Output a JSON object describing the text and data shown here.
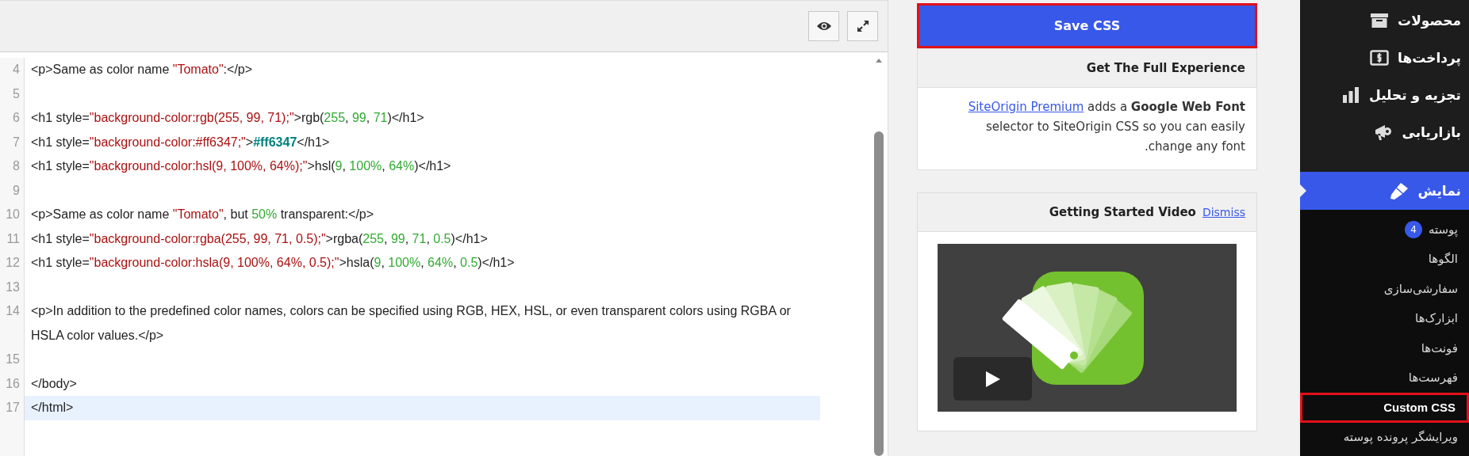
{
  "editor": {
    "toolbar": {
      "buttons": [
        {
          "kind": "preview"
        },
        {
          "kind": "expand"
        }
      ]
    },
    "lines": [
      {
        "number": "4",
        "segments": [
          {
            "kind": "text",
            "text": "<p>Same as color name "
          },
          {
            "kind": "string",
            "text": "\"Tomato\""
          },
          {
            "kind": "text",
            "text": ":</p>"
          }
        ]
      },
      {
        "number": "5"
      },
      {
        "number": "6",
        "segments": [
          {
            "kind": "text",
            "text": "<h1 style="
          },
          {
            "kind": "string",
            "text": "\"background-color:rgb(255, 99, 71);\""
          },
          {
            "kind": "text",
            "text": ">rgb("
          },
          {
            "kind": "number",
            "text": "255"
          },
          {
            "kind": "text",
            "text": ", "
          },
          {
            "kind": "number",
            "text": "99"
          },
          {
            "kind": "text",
            "text": ", "
          },
          {
            "kind": "number",
            "text": "71"
          },
          {
            "kind": "text",
            "text": ")</h1>"
          }
        ]
      },
      {
        "number": "7",
        "segments": [
          {
            "kind": "text",
            "text": "<h1 style="
          },
          {
            "kind": "string",
            "text": "\"background-color:#ff6347;\""
          },
          {
            "kind": "text",
            "text": ">"
          },
          {
            "kind": "color",
            "text": "#ff6347"
          },
          {
            "kind": "text",
            "text": "</h1>"
          }
        ]
      },
      {
        "number": "8",
        "segments": [
          {
            "kind": "text",
            "text": "<h1 style="
          },
          {
            "kind": "string",
            "text": "\"background-color:hsl(9, 100%, 64%);\""
          },
          {
            "kind": "text",
            "text": ">hsl("
          },
          {
            "kind": "number",
            "text": "9"
          },
          {
            "kind": "text",
            "text": ", "
          },
          {
            "kind": "number",
            "text": "100%"
          },
          {
            "kind": "text",
            "text": ", "
          },
          {
            "kind": "number",
            "text": "64%"
          },
          {
            "kind": "text",
            "text": ")</h1>"
          }
        ]
      },
      {
        "number": "9"
      },
      {
        "number": "10",
        "segments": [
          {
            "kind": "text",
            "text": "<p>Same as color name "
          },
          {
            "kind": "string",
            "text": "\"Tomato\""
          },
          {
            "kind": "text",
            "text": ", but "
          },
          {
            "kind": "number",
            "text": "50%"
          },
          {
            "kind": "text",
            "text": " transparent:</p>"
          }
        ]
      },
      {
        "number": "11",
        "segments": [
          {
            "kind": "text",
            "text": "<h1 style="
          },
          {
            "kind": "string",
            "text": "\"background-color:rgba(255, 99, 71, 0.5);\""
          },
          {
            "kind": "text",
            "text": ">rgba("
          },
          {
            "kind": "number",
            "text": "255"
          },
          {
            "kind": "text",
            "text": ", "
          },
          {
            "kind": "number",
            "text": "99"
          },
          {
            "kind": "text",
            "text": ", "
          },
          {
            "kind": "number",
            "text": "71"
          },
          {
            "kind": "text",
            "text": ", "
          },
          {
            "kind": "number",
            "text": "0.5"
          },
          {
            "kind": "text",
            "text": ")</h1>"
          }
        ]
      },
      {
        "number": "12",
        "segments": [
          {
            "kind": "text",
            "text": "<h1 style="
          },
          {
            "kind": "string",
            "text": "\"background-color:hsla(9, 100%, 64%, 0.5);\""
          },
          {
            "kind": "text",
            "text": ">hsla("
          },
          {
            "kind": "number",
            "text": "9"
          },
          {
            "kind": "text",
            "text": ", "
          },
          {
            "kind": "number",
            "text": "100%"
          },
          {
            "kind": "text",
            "text": ", "
          },
          {
            "kind": "number",
            "text": "64%"
          },
          {
            "kind": "text",
            "text": ", "
          },
          {
            "kind": "number",
            "text": "0.5"
          },
          {
            "kind": "text",
            "text": ")</h1>"
          }
        ]
      },
      {
        "number": "13"
      },
      {
        "number": "14",
        "segments": [
          {
            "kind": "text",
            "text": "<p>In addition to the predefined color names, colors can be specified using RGB, HEX, HSL, or even transparent colors using RGBA or HSLA color values.</p>"
          }
        ]
      },
      {
        "number": "15"
      },
      {
        "number": "16",
        "segments": [
          {
            "kind": "text",
            "text": "</body>"
          }
        ]
      },
      {
        "number": "17",
        "active": true,
        "segments": [
          {
            "kind": "text",
            "text": "</html>"
          }
        ]
      }
    ]
  },
  "save_button": {
    "label": "Save CSS",
    "highlighted": true
  },
  "promo_box": {
    "title": "Get The Full Experience",
    "link": "SiteOrigin Premium",
    "text": "adds a **Google Web Font** selector to SiteOrigin CSS so you can easily change any font."
  },
  "video_box": {
    "title": "Getting Started Video",
    "dismiss": "Dismiss"
  },
  "admin_menu": [
    {
      "label": "محصولات",
      "selected": false
    },
    {
      "label": "پرداخت‌ها",
      "selected": false
    },
    {
      "label": "تجزیه و تحلیل",
      "selected": false
    },
    {
      "label": "بازاریابی",
      "selected": false
    },
    {
      "label": "نمایش",
      "selected": true,
      "children": [
        {
          "label": "پوسته",
          "badge": "4",
          "selected": false
        },
        {
          "label": "الگوها",
          "selected": false
        },
        {
          "label": "سفارشی‌سازی",
          "selected": false
        },
        {
          "label": "ابزارک‌ها",
          "selected": false
        },
        {
          "label": "فونت‌ها",
          "selected": false
        },
        {
          "label": "فهرست‌ها",
          "selected": false
        },
        {
          "label": "Custom CSS",
          "selected": true
        },
        {
          "label": "ویرایشگر پرونده پوسته",
          "selected": false
        }
      ]
    }
  ]
}
